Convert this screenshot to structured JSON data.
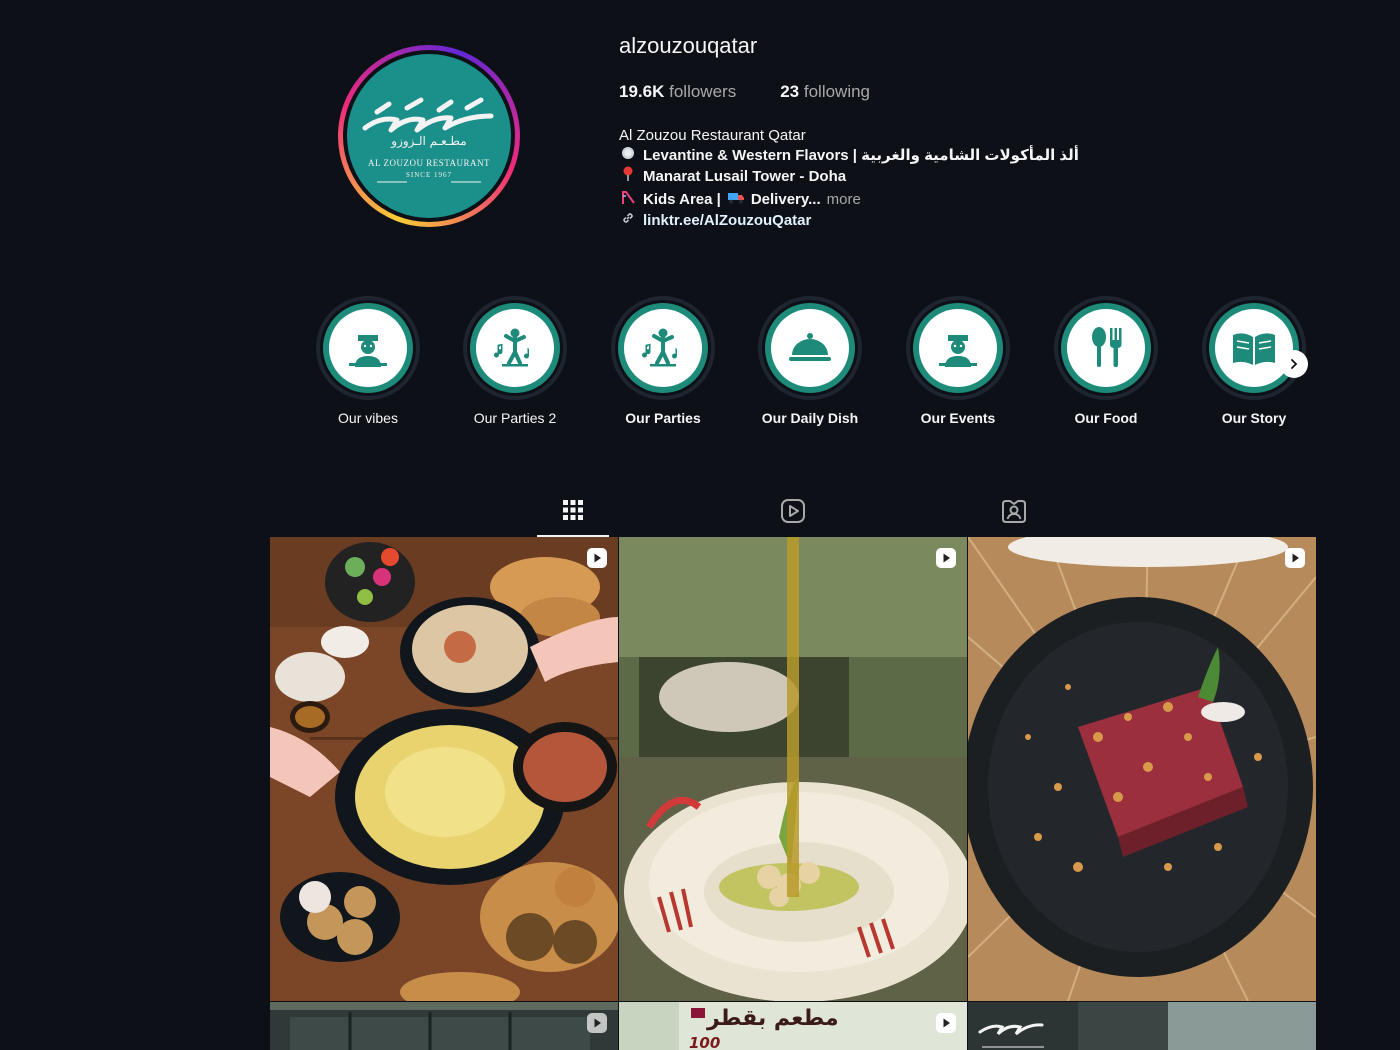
{
  "profile": {
    "username": "alzouzouqatar",
    "followers_count": "19.6K",
    "followers_label": "followers",
    "following_count": "23",
    "following_label": "following",
    "avatar": {
      "logo_arabic": "مطـعـم الـزوزو",
      "logo_english": "AL ZOUZOU RESTAURANT",
      "logo_since": "SINCE 1967"
    },
    "bio": {
      "name": "Al Zouzou Restaurant Qatar",
      "line1_emoji": "plate-icon",
      "line1": "Levantine & Western Flavors | ألذ المأكولات الشامية والغربية",
      "line2_emoji": "pin-icon",
      "line2": "Manarat Lusail Tower - Doha",
      "line3_emoji": "slide-icon",
      "line3_a": "Kids Area |",
      "line3_emoji2": "truck-icon",
      "line3_b": "Delivery...",
      "more": "more",
      "link": "linktr.ee/AlZouzouQatar"
    }
  },
  "highlights": [
    {
      "label": "Our vibes",
      "icon": "waiter-icon"
    },
    {
      "label": "Our Parties 2",
      "icon": "dancer-icon"
    },
    {
      "label": "Our Parties",
      "icon": "dancer-icon"
    },
    {
      "label": "Our Daily Dish",
      "icon": "cloche-icon"
    },
    {
      "label": "Our Events",
      "icon": "waiter-icon"
    },
    {
      "label": "Our Food",
      "icon": "spoon-fork-icon"
    },
    {
      "label": "Our Story",
      "icon": "book-icon"
    }
  ],
  "tabs": [
    {
      "name": "posts",
      "icon": "grid-icon",
      "active": true
    },
    {
      "name": "reels",
      "icon": "reels-icon",
      "active": false
    },
    {
      "name": "tagged",
      "icon": "tagged-icon",
      "active": false
    }
  ],
  "posts": [
    {
      "type": "reel",
      "subject": "mezze spread"
    },
    {
      "type": "reel",
      "subject": "hummus with olive oil"
    },
    {
      "type": "reel",
      "subject": "raw kibbeh plate"
    },
    {
      "type": "reel",
      "subject": "restaurant exterior"
    },
    {
      "type": "reel",
      "subject": "promo",
      "caption_ar_1": "مطعم بقطر",
      "caption_ar_2": "100"
    },
    {
      "type": "post",
      "subject": "logo"
    }
  ],
  "colors": {
    "background": "#0d1117",
    "teal": "#1e8b7a",
    "text_muted": "#a8a8a8"
  }
}
